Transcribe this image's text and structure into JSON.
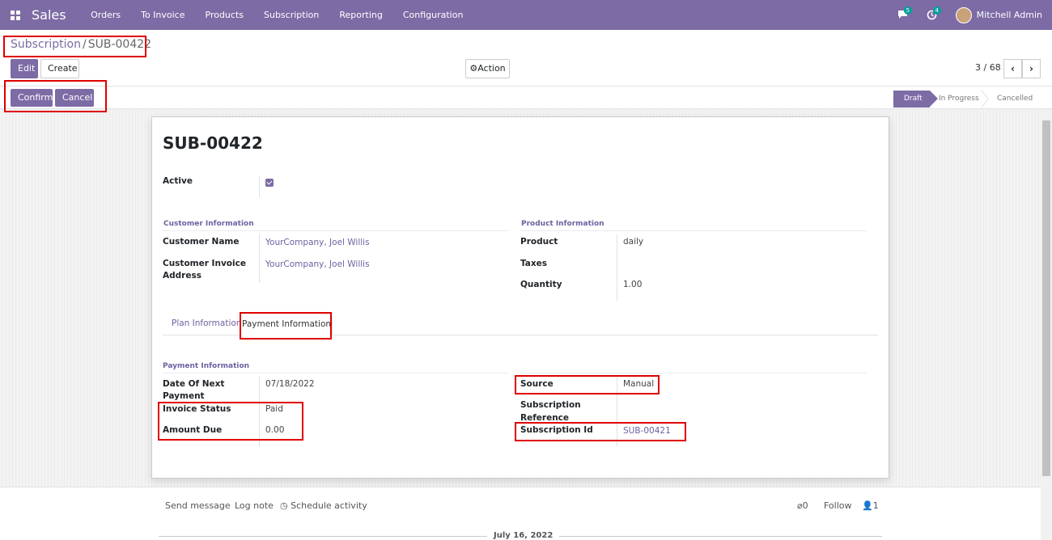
{
  "navbar": {
    "brand": "Sales",
    "menu": [
      "Orders",
      "To Invoice",
      "Products",
      "Subscription",
      "Reporting",
      "Configuration"
    ],
    "messages_count": "5",
    "activities_count": "4",
    "user": "Mitchell Admin"
  },
  "breadcrumb": {
    "parent": "Subscription",
    "separator": "/",
    "current": "SUB-00422"
  },
  "buttons": {
    "edit": "Edit",
    "create": "Create",
    "action": "Action",
    "confirm": "Confirm",
    "cancel": "Cancel"
  },
  "pager": {
    "text": "3 / 68"
  },
  "stages": [
    {
      "label": "Draft",
      "active": true
    },
    {
      "label": "In Progress",
      "active": false
    },
    {
      "label": "Cancelled",
      "active": false
    }
  ],
  "record": {
    "title": "SUB-00422",
    "active_label": "Active",
    "active": true
  },
  "customer_info": {
    "title": "Customer Information",
    "customer_name_label": "Customer Name",
    "customer_name": "YourCompany, Joel Willis",
    "invoice_address_label_1": "Customer Invoice",
    "invoice_address_label_2": "Address",
    "invoice_address": "YourCompany, Joel Willis"
  },
  "product_info": {
    "title": "Product Information",
    "product_label": "Product",
    "product": "daily",
    "taxes_label": "Taxes",
    "taxes": "",
    "quantity_label": "Quantity",
    "quantity": "1.00"
  },
  "tabs": {
    "plan": "Plan Information",
    "payment": "Payment Information"
  },
  "payment_info": {
    "title": "Payment Information",
    "next_payment_label_1": "Date Of Next",
    "next_payment_label_2": "Payment",
    "next_payment": "07/18/2022",
    "invoice_status_label": "Invoice Status",
    "invoice_status": "Paid",
    "amount_due_label": "Amount Due",
    "amount_due": "0.00",
    "source_label": "Source",
    "source": "Manual",
    "sub_ref_label_1": "Subscription",
    "sub_ref_label_2": "Reference",
    "sub_ref": "",
    "sub_id_label": "Subscription Id",
    "sub_id": "SUB-00421"
  },
  "chatter": {
    "send_message": "Send message",
    "log_note": "Log note",
    "schedule_activity": "Schedule activity",
    "attachments": "0",
    "follow": "Follow",
    "followers": "1",
    "date": "July 16, 2022"
  },
  "colors": {
    "brand": "#7c6ba5",
    "highlight": "#e00000"
  }
}
